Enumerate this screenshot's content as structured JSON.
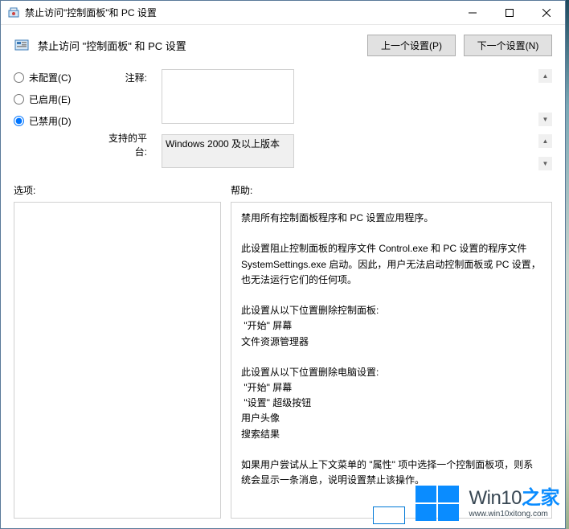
{
  "window": {
    "title": "禁止访问\"控制面板\"和 PC 设置"
  },
  "toolbar": {
    "title": "禁止访问 \"控制面板\" 和 PC 设置",
    "prev_label": "上一个设置(P)",
    "next_label": "下一个设置(N)"
  },
  "radios": {
    "not_configured": "未配置(C)",
    "enabled": "已启用(E)",
    "disabled": "已禁用(D)",
    "selected": "disabled"
  },
  "labels": {
    "notes": "注释:",
    "platforms": "支持的平台:",
    "options": "选项:",
    "help": "帮助:"
  },
  "fields": {
    "notes_value": "",
    "platforms_value": "Windows 2000 及以上版本"
  },
  "help_text": "禁用所有控制面板程序和 PC 设置应用程序。\n\n此设置阻止控制面板的程序文件 Control.exe 和 PC 设置的程序文件 SystemSettings.exe 启动。因此，用户无法启动控制面板或 PC 设置，也无法运行它们的任何项。\n\n此设置从以下位置删除控制面板:\n \"开始\" 屏幕\n文件资源管理器\n\n此设置从以下位置删除电脑设置:\n \"开始\" 屏幕\n \"设置\" 超级按钮\n用户头像\n搜索结果\n\n如果用户尝试从上下文菜单的 \"属性\" 项中选择一个控制面板项，则系统会显示一条消息，说明设置禁止该操作。",
  "watermark": {
    "brand_main": "Win10",
    "brand_sub": "之家",
    "url": "www.win10xitong.com"
  }
}
